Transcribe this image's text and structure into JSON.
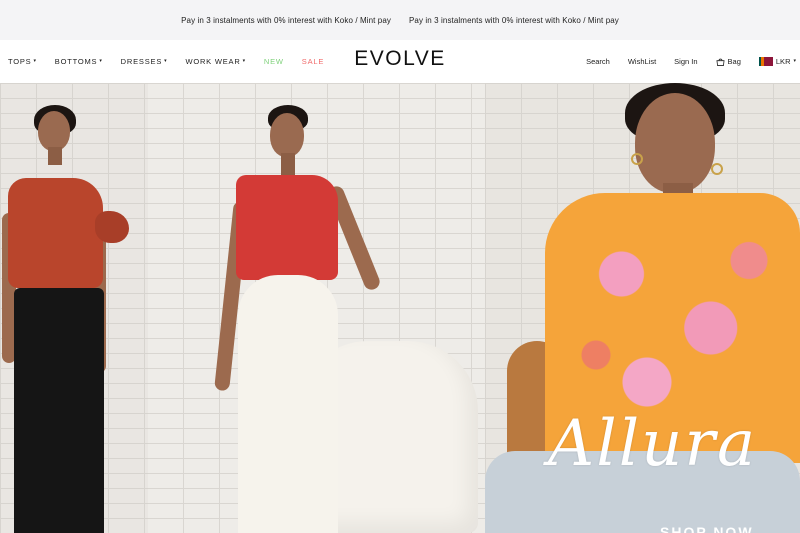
{
  "announcement": {
    "messages": [
      "Pay in 3 instalments with 0% interest with Koko / Mint pay",
      "Pay in 3 instalments with 0% interest with Koko / Mint pay"
    ]
  },
  "nav": {
    "items": [
      {
        "label": "TOPS",
        "has_dropdown": true
      },
      {
        "label": "BOTTOMS",
        "has_dropdown": true
      },
      {
        "label": "DRESSES",
        "has_dropdown": true
      },
      {
        "label": "WORK WEAR",
        "has_dropdown": true
      },
      {
        "label": "NEW",
        "has_dropdown": false,
        "color": "#7ed17a"
      },
      {
        "label": "SALE",
        "has_dropdown": false,
        "color": "#f06a6a"
      }
    ],
    "logo": "EVOLVE",
    "utility": {
      "search": "Search",
      "wishlist": "WishList",
      "signin": "Sign In",
      "bag": "Bag",
      "currency": "LKR"
    }
  },
  "hero": {
    "brand_script": "Allura",
    "cta": "SHOP NOW",
    "colors": {
      "top_rust": "#b9452c",
      "top_red": "#d33a36",
      "shirt_orange": "#f5a43a",
      "shirt_pink": "#f29ab8"
    }
  }
}
